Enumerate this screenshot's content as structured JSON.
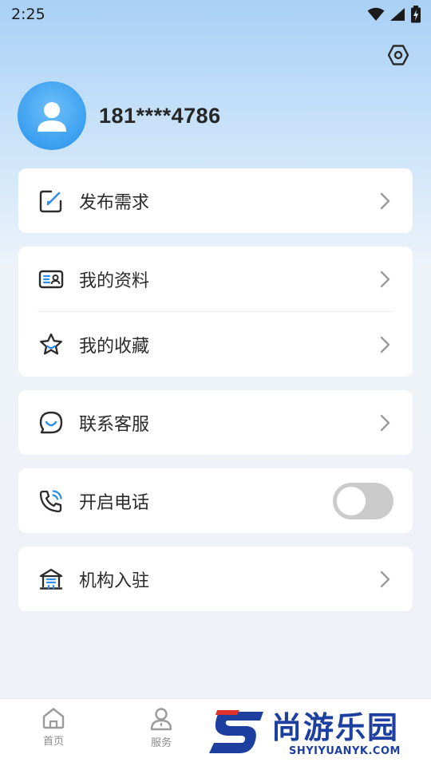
{
  "status_bar": {
    "time": "2:25"
  },
  "profile": {
    "phone": "181****4786"
  },
  "menu": {
    "post_demand": "发布需求",
    "my_profile": "我的资料",
    "my_favorites": "我的收藏",
    "contact_service": "联系客服",
    "enable_phone": "开启电话",
    "enable_phone_on": false,
    "institution_join": "机构入驻"
  },
  "tabbar": {
    "home": "首页",
    "service": "服务"
  },
  "watermark": {
    "cn": "尚游乐园",
    "en": "SHYIYUANYK.COM"
  },
  "colors": {
    "accent": "#3a9ef0",
    "icon_dark": "#2b2b2b",
    "icon_blue": "#2f8fe6"
  }
}
